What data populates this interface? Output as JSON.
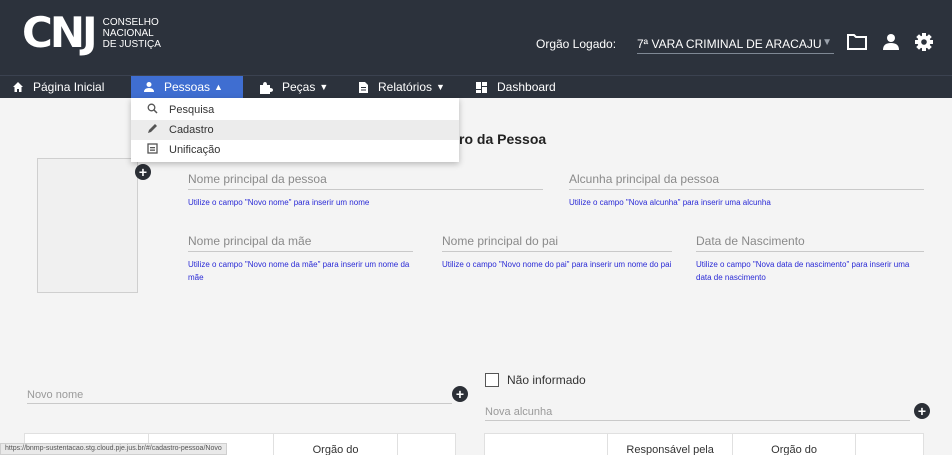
{
  "header": {
    "logo_mark": "CNJ",
    "logo_lines": [
      "CONSELHO",
      "NACIONAL",
      "DE JUSTIÇA"
    ],
    "orgao_label": "Orgão Logado:",
    "orgao_value": "7ª VARA CRIMINAL DE ARACAJU"
  },
  "nav": {
    "items": [
      {
        "label": "Página Inicial",
        "icon": "home-icon"
      },
      {
        "label": "Pessoas",
        "icon": "person-icon",
        "active": true
      },
      {
        "label": "Peças",
        "icon": "puzzle-icon"
      },
      {
        "label": "Relatórios",
        "icon": "document-icon"
      },
      {
        "label": "Dashboard",
        "icon": "dashboard-icon"
      }
    ]
  },
  "dropdown": {
    "items": [
      {
        "label": "Pesquisa",
        "icon": "search-icon"
      },
      {
        "label": "Cadastro",
        "icon": "pencil-icon"
      },
      {
        "label": "Unificação",
        "icon": "merge-icon"
      }
    ]
  },
  "main": {
    "title": "ro da Pessoa",
    "fields": {
      "nome": {
        "label": "Nome principal da pessoa",
        "hint": "Utilize o campo \"Novo nome\" para inserir um nome"
      },
      "alcunha": {
        "label": "Alcunha principal da pessoa",
        "hint": "Utilize o campo \"Nova alcunha\" para inserir uma alcunha"
      },
      "mae": {
        "label": "Nome principal da mãe",
        "hint": "Utilize o campo \"Novo nome da mãe\" para inserir um nome da mãe"
      },
      "pai": {
        "label": "Nome principal do pai",
        "hint": "Utilize o campo \"Novo nome do pai\" para inserir um nome do pai"
      },
      "nascimento": {
        "label": "Data de Nascimento",
        "hint": "Utilize o campo \"Nova data de nascimento\" para inserir uma data de nascimento"
      }
    },
    "novo_nome_placeholder": "Novo nome",
    "nao_informado": "Não informado",
    "nova_alcunha_placeholder": "Nova alcunha",
    "table_left_headers": [
      "",
      "",
      "Orgão do",
      ""
    ],
    "table_right_headers": [
      "",
      "Responsável pela",
      "Orgão do",
      ""
    ]
  },
  "status_url": "https://bnmp-sustentacao.stg.cloud.pje.jus.br/#/cadastro-pessoa/Novo"
}
